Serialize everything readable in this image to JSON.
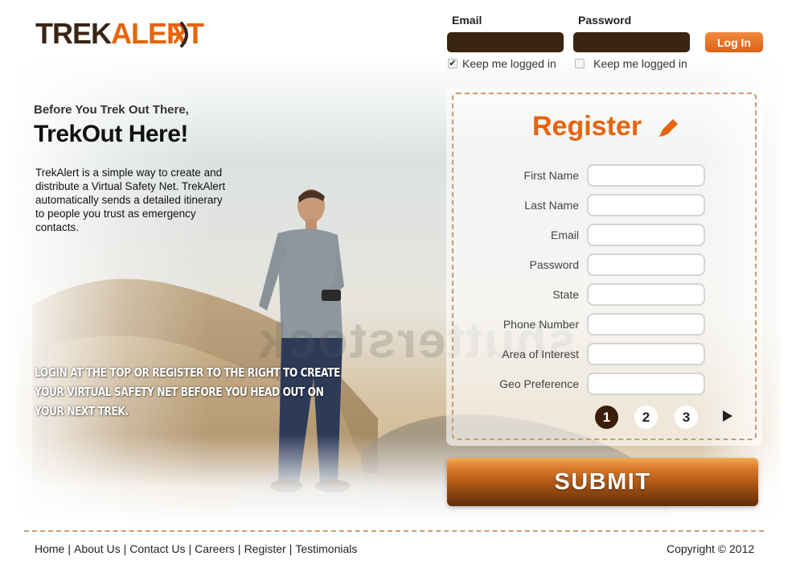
{
  "brand": {
    "logo_part1": "TREK",
    "logo_part2": "ALERT"
  },
  "login": {
    "email_label": "Email",
    "password_label": "Password",
    "button_label": "Log In",
    "keep_left": "Keep me logged in",
    "keep_right": "Keep me logged in",
    "keep_left_checked": "✔"
  },
  "intro": {
    "pre_title": "Before You Trek Out There,",
    "title": "TrekOut Here!",
    "description": "TrekAlert is a simple way to create and distribute a Virtual Safety Net. TrekAlert automatically sends a detailed itinerary to people you trust as emergency contacts.",
    "cta": "Login at the top or register to the right to create your virtual safety net before you head out on your next trek."
  },
  "register": {
    "title": "Register",
    "fields": [
      "First Name",
      "Last Name",
      "Email",
      "Password",
      "State",
      "Phone Number",
      "Area of Interest",
      "Geo Preference"
    ],
    "pages": [
      "1",
      "2",
      "3"
    ],
    "submit_label": "SUBMIT"
  },
  "watermark": "shutterstock",
  "footer": {
    "links": [
      "Home",
      "About Us",
      "Contact Us",
      "Careers",
      "Register",
      "Testimonials"
    ],
    "copyright": "Copyright © 2012"
  },
  "colors": {
    "accent": "#e8630a",
    "dark_brown": "#3a2412",
    "dashed_border": "#c89a6e"
  }
}
